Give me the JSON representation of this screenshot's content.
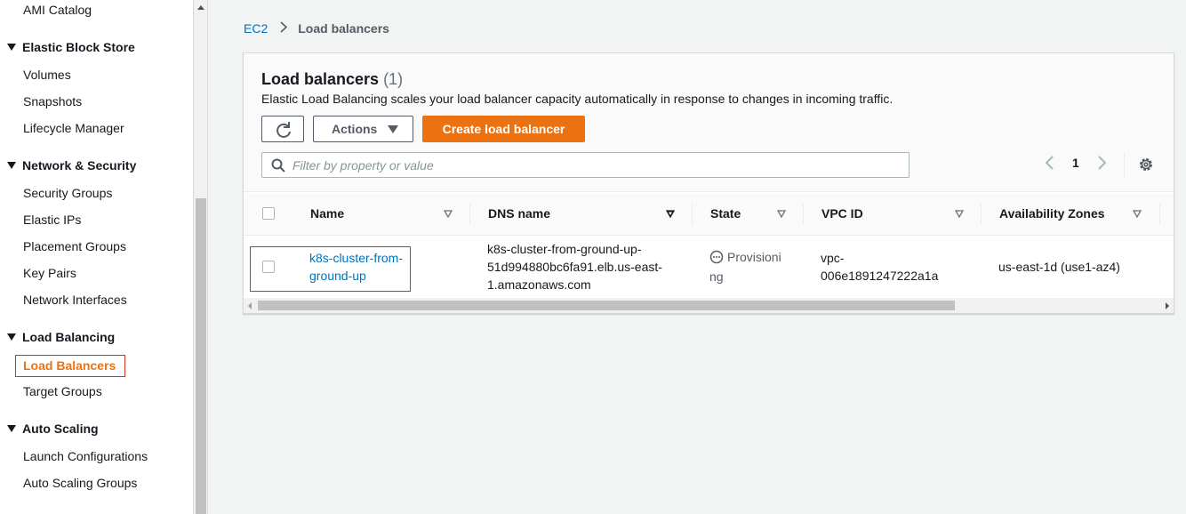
{
  "sidebar": {
    "items": [
      {
        "type": "item",
        "label": "AMI Catalog"
      },
      {
        "type": "section",
        "label": "Elastic Block Store"
      },
      {
        "type": "item",
        "label": "Volumes"
      },
      {
        "type": "item",
        "label": "Snapshots"
      },
      {
        "type": "item",
        "label": "Lifecycle Manager"
      },
      {
        "type": "section",
        "label": "Network & Security"
      },
      {
        "type": "item",
        "label": "Security Groups"
      },
      {
        "type": "item",
        "label": "Elastic IPs"
      },
      {
        "type": "item",
        "label": "Placement Groups"
      },
      {
        "type": "item",
        "label": "Key Pairs"
      },
      {
        "type": "item",
        "label": "Network Interfaces"
      },
      {
        "type": "section",
        "label": "Load Balancing"
      },
      {
        "type": "item",
        "label": "Load Balancers",
        "active": true
      },
      {
        "type": "item",
        "label": "Target Groups"
      },
      {
        "type": "section",
        "label": "Auto Scaling"
      },
      {
        "type": "item",
        "label": "Launch Configurations"
      },
      {
        "type": "item",
        "label": "Auto Scaling Groups"
      }
    ]
  },
  "breadcrumb": {
    "root": "EC2",
    "current": "Load balancers"
  },
  "panel": {
    "title": "Load balancers",
    "count": "(1)",
    "description": "Elastic Load Balancing scales your load balancer capacity automatically in response to changes in incoming traffic.",
    "actions_label": "Actions",
    "create_label": "Create load balancer",
    "filter_placeholder": "Filter by property or value",
    "page_number": "1"
  },
  "table": {
    "columns": [
      "Name",
      "DNS name",
      "State",
      "VPC ID",
      "Availability Zones"
    ],
    "rows": [
      {
        "name_line1": "k8s-cluster-from-",
        "name_line2": "ground-up",
        "dns_line1": "k8s-cluster-from-ground-up-",
        "dns_line2": "51d994880bc6fa91.elb.us-east-",
        "dns_line3": "1.amazonaws.com",
        "state_line1": "Provisioni",
        "state_line2": "ng",
        "vpc_line1": "vpc-",
        "vpc_line2": "006e1891247222a1a",
        "az": "us-east-1d (use1-az4)"
      }
    ]
  },
  "colors": {
    "accent": "#ec7211",
    "link": "#0073bb",
    "highlight": "#d13212"
  }
}
